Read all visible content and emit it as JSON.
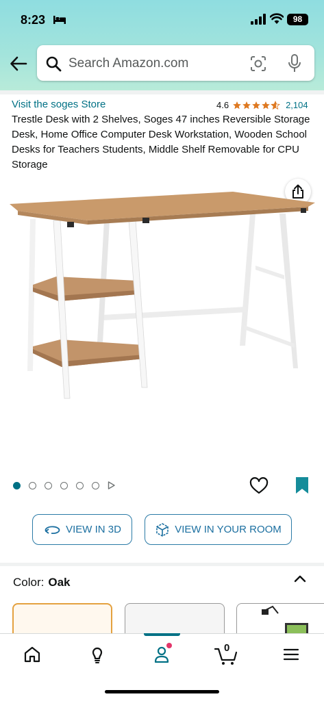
{
  "status_bar": {
    "time": "8:23",
    "battery": "98",
    "icons": [
      "bed-icon",
      "cellular-signal-icon",
      "wifi-icon",
      "battery-icon"
    ]
  },
  "search": {
    "placeholder": "Search Amazon.com",
    "icons": [
      "back-arrow-icon",
      "search-icon",
      "camera-lens-icon",
      "microphone-icon"
    ]
  },
  "product": {
    "store_link": "Visit the soges Store",
    "rating_value": "4.6",
    "stars": 4.6,
    "rating_count": "2,104",
    "title": "Trestle Desk with 2 Shelves, Soges 47 inches Reversible Storage Desk, Home Office Computer Desk Workstation, Wooden School Desks for Teachers Students, Middle Shelf Removable for CPU Storage"
  },
  "carousel": {
    "total_images": 6,
    "active_index": 0
  },
  "buttons": {
    "view_3d": "VIEW IN 3D",
    "view_room": "VIEW IN YOUR ROOM"
  },
  "color": {
    "label": "Color:",
    "value": "Oak"
  },
  "nav": {
    "cart_count": "0",
    "items": [
      "home-icon",
      "lightbulb-icon",
      "account-icon",
      "cart-icon",
      "menu-icon"
    ],
    "active": "account-icon"
  },
  "colors": {
    "link": "#007185",
    "star": "#de7921",
    "button_border": "#2a7aa6",
    "selected_swatch": "#e4a13f"
  }
}
